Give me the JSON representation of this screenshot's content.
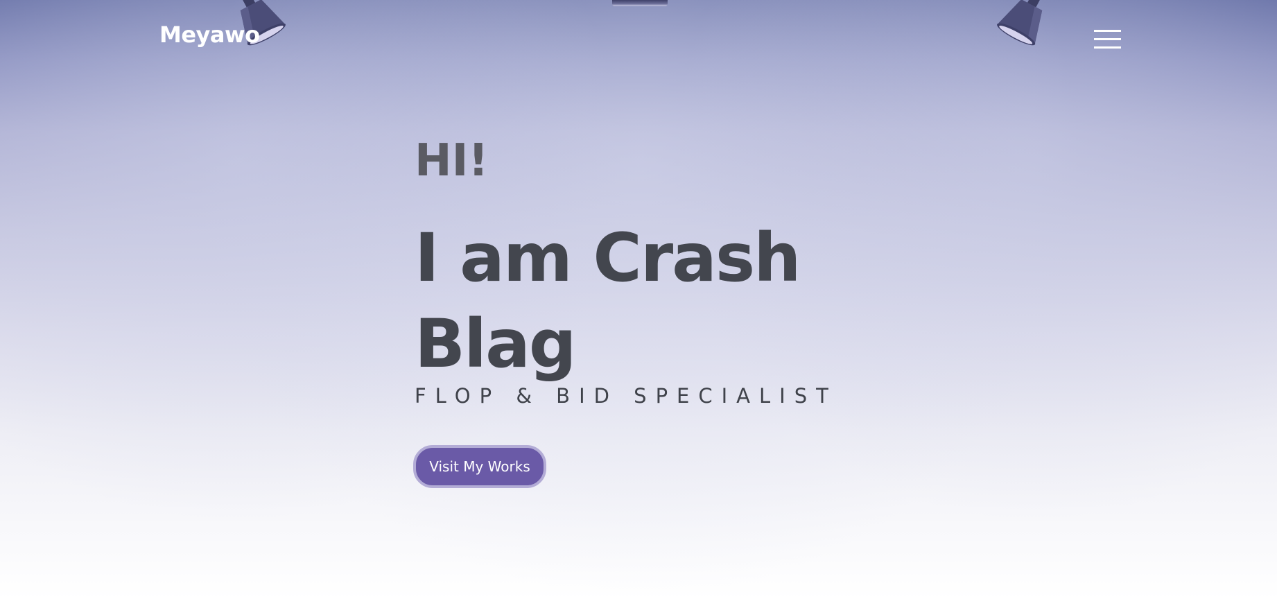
{
  "nav": {
    "brand": "Meyawo",
    "menu_icon": "hamburger-menu-icon"
  },
  "hero": {
    "greeting": "HI!",
    "headline": "I am Crash Blag",
    "tagline": "FLOP & BID SPECIALIST",
    "cta_label": "Visit My Works"
  },
  "decor": {
    "left_icon": "spotlight-icon",
    "right_icon": "spotlight-icon",
    "center_icon": "ceiling-lamp-icon"
  },
  "colors": {
    "brand_text": "#ffffff",
    "headline": "#43464e",
    "accent_button": "#6a5aa7",
    "button_ring": "#b3acd6"
  }
}
